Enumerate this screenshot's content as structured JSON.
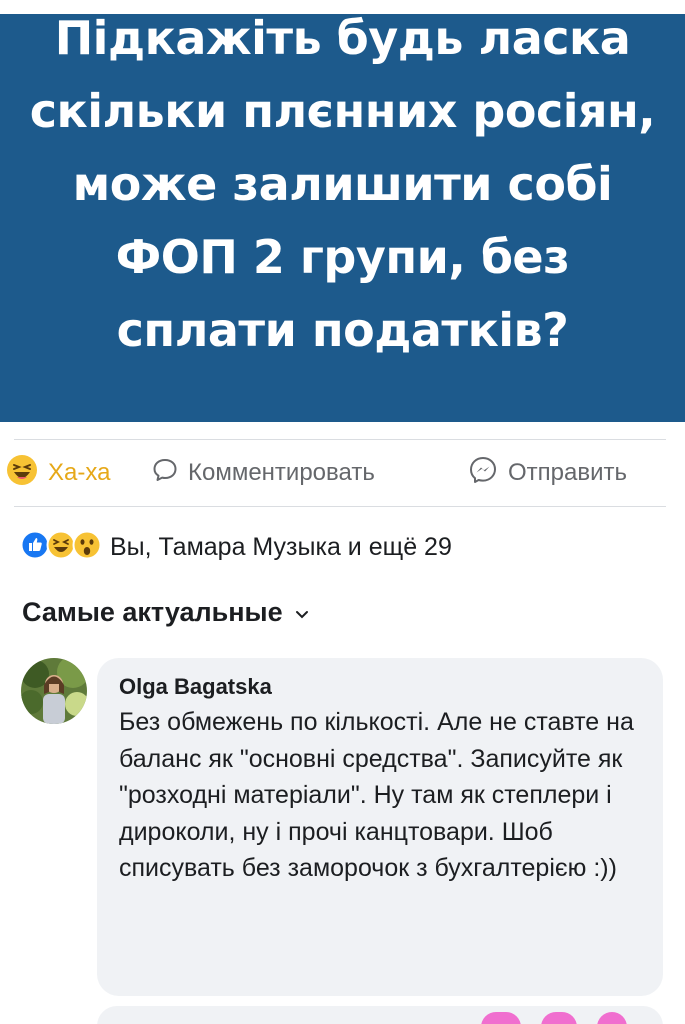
{
  "post": {
    "image_lines": [
      "Підкажіть будь ласка",
      "скільки плєнних росіян,",
      "може залишити собі",
      "ФОП 2 групи, без",
      "сплати податків?"
    ]
  },
  "actions": {
    "haha_label": "Ха-ха",
    "comment_label": "Комментировать",
    "send_label": "Отправить"
  },
  "reactions": {
    "icons": [
      "like-icon",
      "haha-icon",
      "wow-icon"
    ],
    "summary": "Вы, Тамара Музыка и ещё 29"
  },
  "comments": {
    "sort_label": "Самые актуальные",
    "items": [
      {
        "author": "Olga Bagatska",
        "text": "Без обмежень по кількості. Але не ставте на баланс як \"основні средства\". Записуйте як \"розходні матеріали\".  Ну там як степлери і дироколи, ну і прочі канцтовари. Шоб списувать без заморочок з бухгалтерією :))"
      }
    ]
  },
  "colors": {
    "image_bg": "#1d5a8c",
    "haha": "#e6a818",
    "muted": "#65676b",
    "bubble_bg": "#f0f2f5",
    "like_blue": "#1877f2"
  }
}
